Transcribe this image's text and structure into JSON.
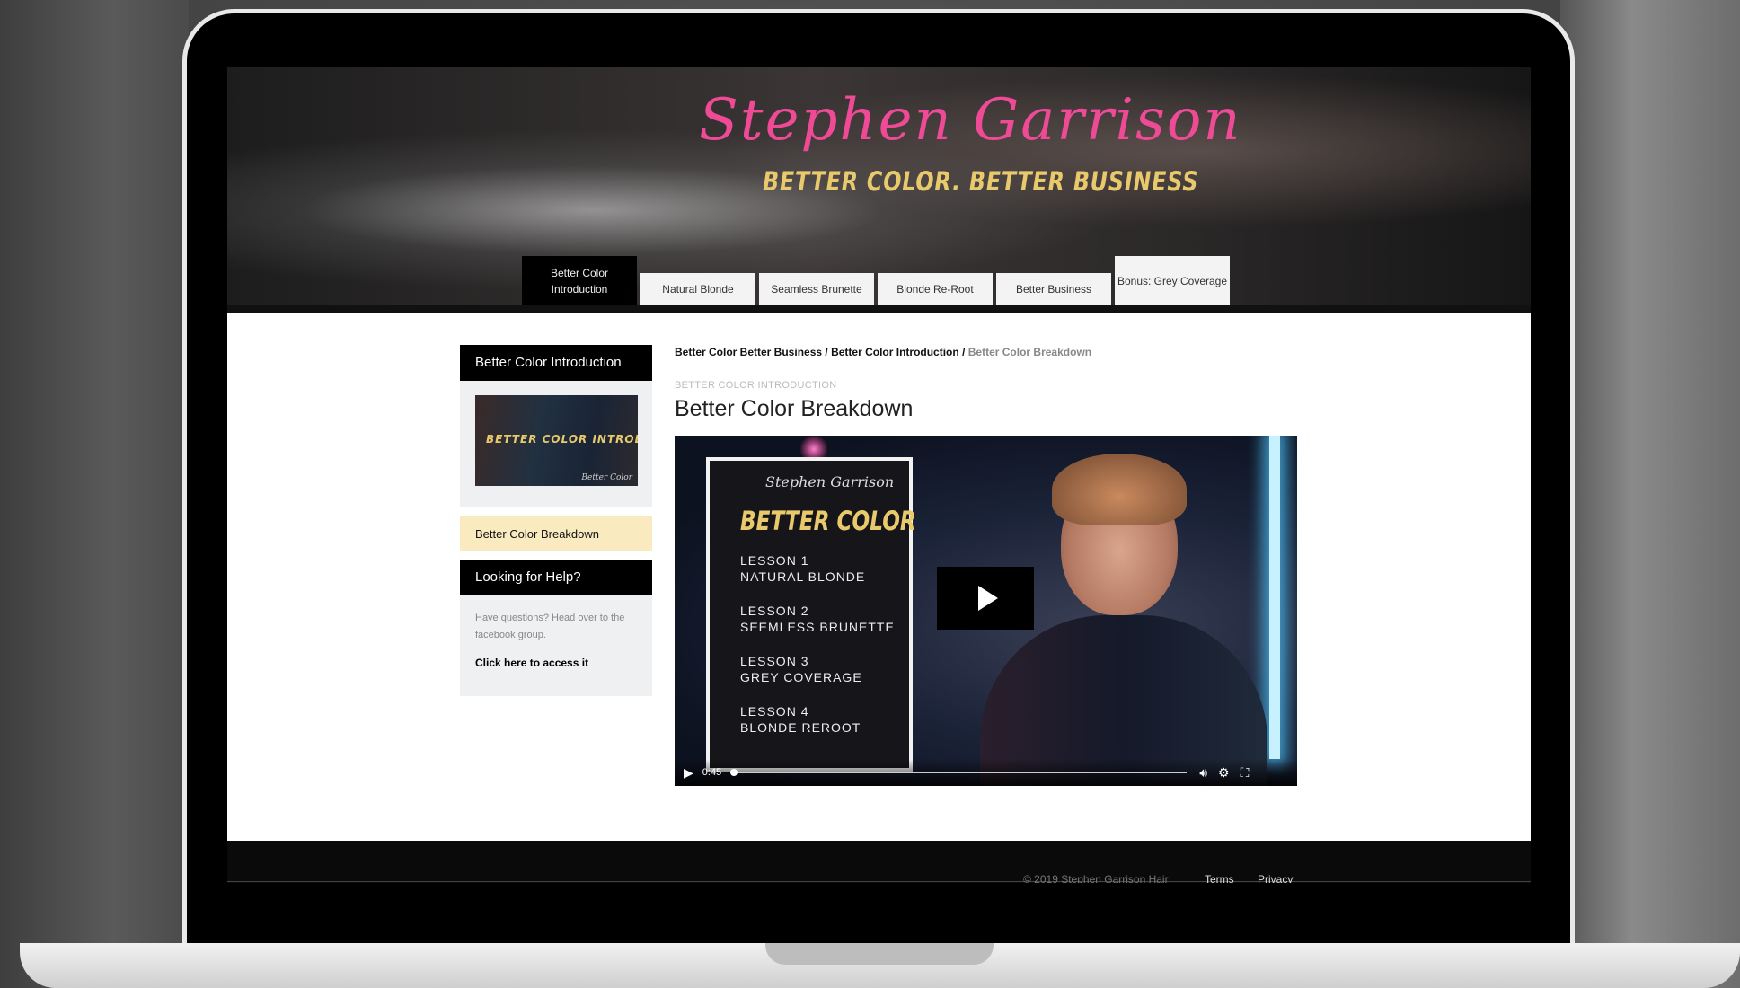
{
  "brand": {
    "script_name": "Stephen Garrison",
    "tagline": "BETTER COLOR. BETTER BUSINESS"
  },
  "tabs": [
    {
      "label": "Better Color Introduction",
      "active": true
    },
    {
      "label": "Natural Blonde",
      "active": false
    },
    {
      "label": "Seamless Brunette",
      "active": false
    },
    {
      "label": "Blonde Re-Root",
      "active": false
    },
    {
      "label": "Better Business",
      "active": false
    },
    {
      "label": "Bonus: Grey Coverage",
      "active": false
    }
  ],
  "sidebar": {
    "section_title": "Better Color Introduction",
    "thumbnail_text": "BETTER COLOR INTRODUCTION",
    "thumbnail_signature": "Better Color",
    "lesson_item": "Better Color Breakdown",
    "help_title": "Looking for Help?",
    "help_text": "Have questions? Head over to the facebook group.",
    "help_link": "Click here to access it"
  },
  "breadcrumb": {
    "part1": "Better Color Better Business",
    "sep": " / ",
    "part2": "Better Color Introduction",
    "current": "Better Color Breakdown"
  },
  "main": {
    "kicker": "BETTER COLOR INTRODUCTION",
    "title": "Better Color Breakdown"
  },
  "video": {
    "card_signature": "Stephen Garrison",
    "card_title": "BETTER COLOR",
    "lessons": [
      {
        "num": "LESSON 1",
        "name": "NATURAL BLONDE"
      },
      {
        "num": "LESSON 2",
        "name": "SEEMLESS BRUNETTE"
      },
      {
        "num": "LESSON 3",
        "name": "GREY COVERAGE"
      },
      {
        "num": "LESSON 4",
        "name": "BLONDE REROOT"
      }
    ],
    "time": "0:45",
    "icons": {
      "play": "play-icon",
      "volume": "volume-icon",
      "settings": "gear-icon",
      "fullscreen": "fullscreen-icon"
    }
  },
  "footer": {
    "copyright": "© 2019 Stephen Garrison Hair",
    "terms": "Terms",
    "privacy": "Privacy"
  },
  "colors": {
    "accent_pink": "#ee4a96",
    "accent_gold": "#e8c96b",
    "highlight": "#f9eabf"
  }
}
